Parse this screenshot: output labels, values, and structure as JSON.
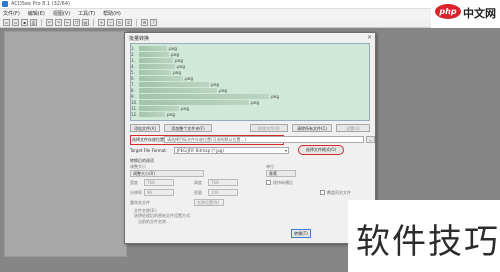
{
  "app": {
    "title": "ACDSee Pro 8.1 (32/64)"
  },
  "menu": [
    "文件(F)",
    "编辑(E)",
    "视图(V)",
    "工具(T)",
    "帮助(H)"
  ],
  "toolbar": {
    "icons": [
      "new-icon",
      "open-icon",
      "save-icon",
      "print-icon",
      "undo-icon",
      "redo-icon",
      "cut-icon",
      "copy-icon",
      "paste-icon",
      "zoom-in-icon",
      "zoom-out-icon",
      "rotate-icon",
      "crop-icon",
      "settings-icon",
      "help-icon"
    ]
  },
  "dialog": {
    "title": "批量转换",
    "close": "×",
    "files": [
      {
        "index": "1.",
        "ext": ".png"
      },
      {
        "index": "2.",
        "ext": ".png"
      },
      {
        "index": "3.",
        "ext": ".png"
      },
      {
        "index": "4.",
        "ext": ".png"
      },
      {
        "index": "5.",
        "ext": ".png"
      },
      {
        "index": "6.",
        "ext": ".png"
      },
      {
        "index": "7.",
        "ext": ".png"
      },
      {
        "index": "8.",
        "ext": ".png"
      },
      {
        "index": "9.",
        "ext": ".png"
      },
      {
        "index": "10.",
        "ext": ".png"
      },
      {
        "index": "11.",
        "ext": ".png"
      },
      {
        "index": "12.",
        "ext": ".png"
      }
    ],
    "buttons": {
      "add_file": "添加文件(A)",
      "add_folder": "添加整个文件夹(F)",
      "remove": "移除文件(R)",
      "remove_all": "清除所有文件(C)",
      "settings": "设置(S)"
    },
    "output": {
      "label": "选择文件存放位置",
      "value": "请选择目标文件存放位置(可选的默认位置...)",
      "browse": "..."
    },
    "format": {
      "label": "Target File Format:",
      "value": "JPEG/JFIF Bitmap (*.jpg)",
      "select_button": "选择文件格式(O)"
    },
    "section_title": "转换后的选项",
    "options": {
      "resize_label": "调整大小",
      "resize_value": "调整大小(R)",
      "width_label": "宽度",
      "width_value": "768",
      "height_label": "高度",
      "height_value": "768",
      "unit_label": "单位",
      "unit_value": "像素",
      "keep_ratio": "保持纵横比",
      "dpi_label": "分辨率",
      "dpi_value": "96",
      "quality_label": "质量",
      "quality_value": "100",
      "name_label": "重命名文件",
      "name_value": "名称设置(N)",
      "overwrite": "覆盖同名文件",
      "note1": "文件名称(E):",
      "note2": "选择处理后的原始文件设置方式:",
      "note3": "当前的文件名称..."
    },
    "ok": "转换(T)",
    "help": "?"
  },
  "branding": {
    "logo_text": "php",
    "logo_suffix": "中文网",
    "watermark": "软件技巧"
  }
}
